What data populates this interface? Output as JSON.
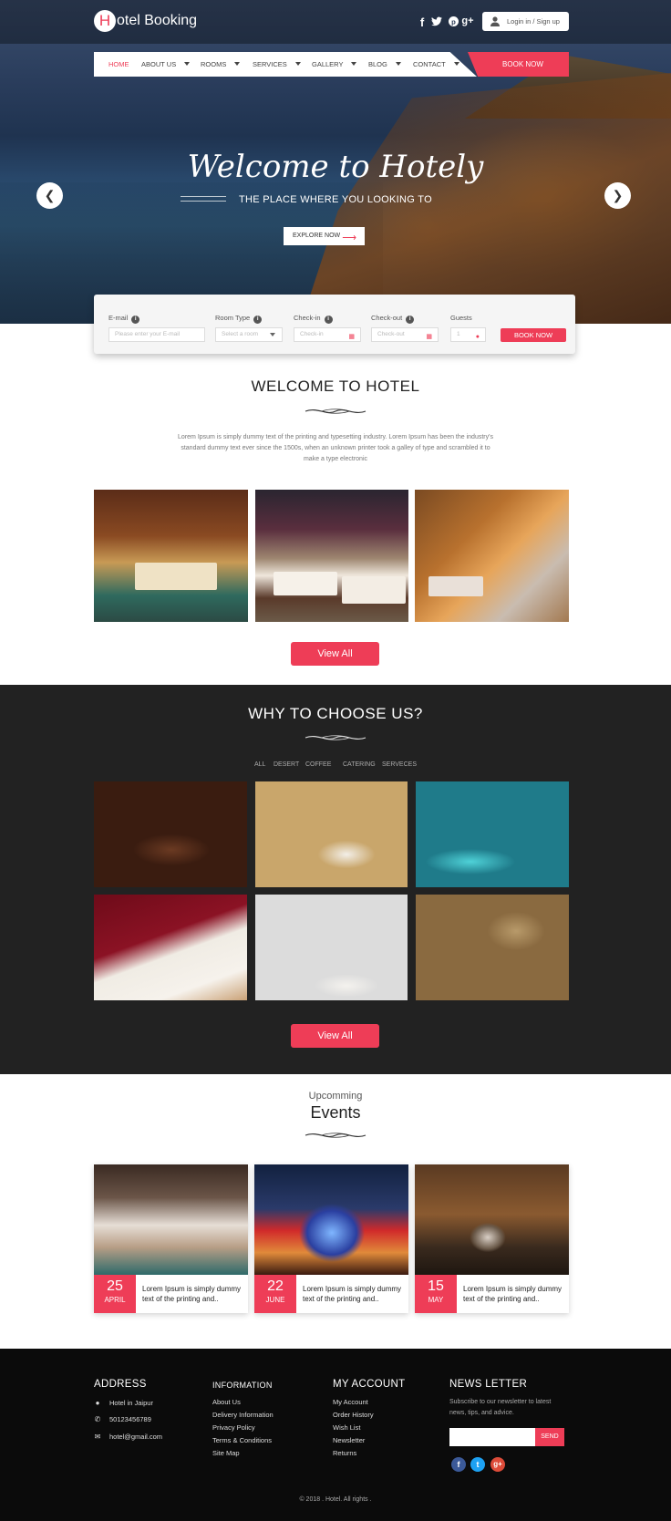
{
  "brand": {
    "logo_letter": "H",
    "logo_rest": "otel Booking"
  },
  "header": {
    "social": [
      {
        "icon": "facebook-icon",
        "glyph": "f"
      },
      {
        "icon": "twitter-icon",
        "glyph": "t"
      },
      {
        "icon": "pinterest-icon",
        "glyph": "p"
      },
      {
        "icon": "google-plus-icon",
        "glyph": "g+"
      }
    ],
    "login_label": "Login in / Sign up"
  },
  "nav": {
    "items": [
      "HOME",
      "ABOUT US",
      "ROOMS",
      "SERVICES",
      "GALLERY",
      "BLOG",
      "CONTACT"
    ],
    "book_now": "BOOK NOW"
  },
  "hero": {
    "title": "Welcome to Hotely",
    "subtitle": "THE PLACE WHERE YOU LOOKING TO",
    "cta": "EXPLORE NOW",
    "prev_icon": "chevron-left-icon",
    "next_icon": "chevron-right-icon"
  },
  "booking": {
    "email_label": "E-mail",
    "email_placeholder": "Please enter your E-mail",
    "room_type_label": "Room Type",
    "room_type_value": "Select a room",
    "checkin_label": "Check-in",
    "checkin_placeholder": "Check-in",
    "checkout_label": "Check-out",
    "checkout_placeholder": "Check-out",
    "guests_label": "Guests",
    "guests_value": "1",
    "submit": "BOOK NOW"
  },
  "welcome": {
    "title": "WELCOME TO HOTEL",
    "text": "Lorem Ipsum is simply dummy text of the printing and typesetting industry. Lorem Ipsum has been the industry's standard dummy text ever since the 1500s, when an unknown printer took a galley of type and scrambled it to make a type electronic",
    "view_all": "View All"
  },
  "why": {
    "title": "WHY TO CHOOSE US?",
    "filters": [
      "ALL",
      "DESERT",
      "COFFEE",
      "CATERING",
      "SERVECES"
    ],
    "view_all": "View All"
  },
  "events": {
    "kicker": "Upcomming",
    "title": "Events",
    "cards": [
      {
        "day": "25",
        "month": "APRIL",
        "text": "Lorem Ipsum is simply dummy text of the printing and.."
      },
      {
        "day": "22",
        "month": "JUNE",
        "text": "Lorem Ipsum is simply dummy text of the printing and.."
      },
      {
        "day": "15",
        "month": "MAY",
        "text": "Lorem Ipsum is simply dummy text of the printing and.."
      }
    ]
  },
  "footer": {
    "address": {
      "heading": "ADDRESS",
      "location": "Hotel in Jaipur",
      "phone": "50123456789",
      "email": "hotel@gmail.com"
    },
    "information": {
      "heading": "INFORMATION",
      "links": [
        "About Us",
        "Delivery Information",
        "Privacy Policy",
        "Terms & Conditions",
        "Site Map"
      ]
    },
    "account": {
      "heading": "MY ACCOUNT",
      "links": [
        "My Account",
        "Order History",
        "Wish List",
        "Newsletter",
        "Returns"
      ]
    },
    "newsletter": {
      "heading": "NEWS LETTER",
      "text": "Subscribe to our newsletter to latest news, tips, and advice.",
      "placeholder": "",
      "send": "SEND"
    },
    "copyright": "© 2018 . Hotel. All rights ."
  },
  "colors": {
    "accent": "#ee3d57",
    "dark": "#222222",
    "footer": "#0b0b0b"
  }
}
